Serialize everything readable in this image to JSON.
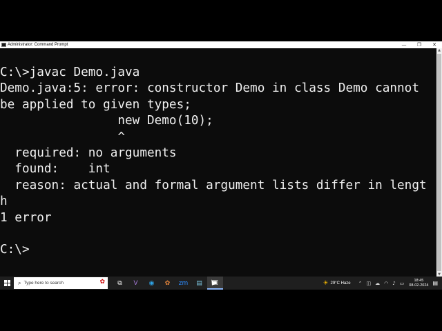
{
  "window": {
    "title": "Administrator: Command Prompt",
    "controls": {
      "minimize": "—",
      "maximize": "❐",
      "close": "✕"
    }
  },
  "console": {
    "lines": [
      "C:\\>javac Demo.java",
      "Demo.java:5: error: constructor Demo in class Demo cannot",
      "be applied to given types;",
      "                new Demo(10);",
      "                ^",
      "  required: no arguments",
      "  found:    int",
      "  reason: actual and formal argument lists differ in lengt",
      "h",
      "1 error",
      "",
      "C:\\>"
    ]
  },
  "taskbar": {
    "search_placeholder": "Type here to search",
    "apps": [
      {
        "name": "task-view-icon",
        "glyph": "⧉",
        "color": "#ffffff"
      },
      {
        "name": "visual-studio-icon",
        "glyph": "V",
        "color": "#a77bd9"
      },
      {
        "name": "edge-icon",
        "glyph": "◉",
        "color": "#2fa4e7"
      },
      {
        "name": "paint-icon",
        "glyph": "✿",
        "color": "#e8873c"
      },
      {
        "name": "zoom-icon",
        "glyph": "zm",
        "color": "#2d8cff"
      },
      {
        "name": "notepad-icon",
        "glyph": "▤",
        "color": "#7ec8e3"
      },
      {
        "name": "command-prompt-icon",
        "glyph": "▣",
        "color": "#ffffff"
      }
    ],
    "weather": {
      "temp": "29°C",
      "condition": "Haze"
    },
    "clock": {
      "time": "18:45",
      "date": "08-02-2024"
    }
  },
  "colors": {
    "console_bg": "#0c0c0c",
    "console_text": "#f0f0f0",
    "taskbar_bg": "#1f1f1f"
  }
}
